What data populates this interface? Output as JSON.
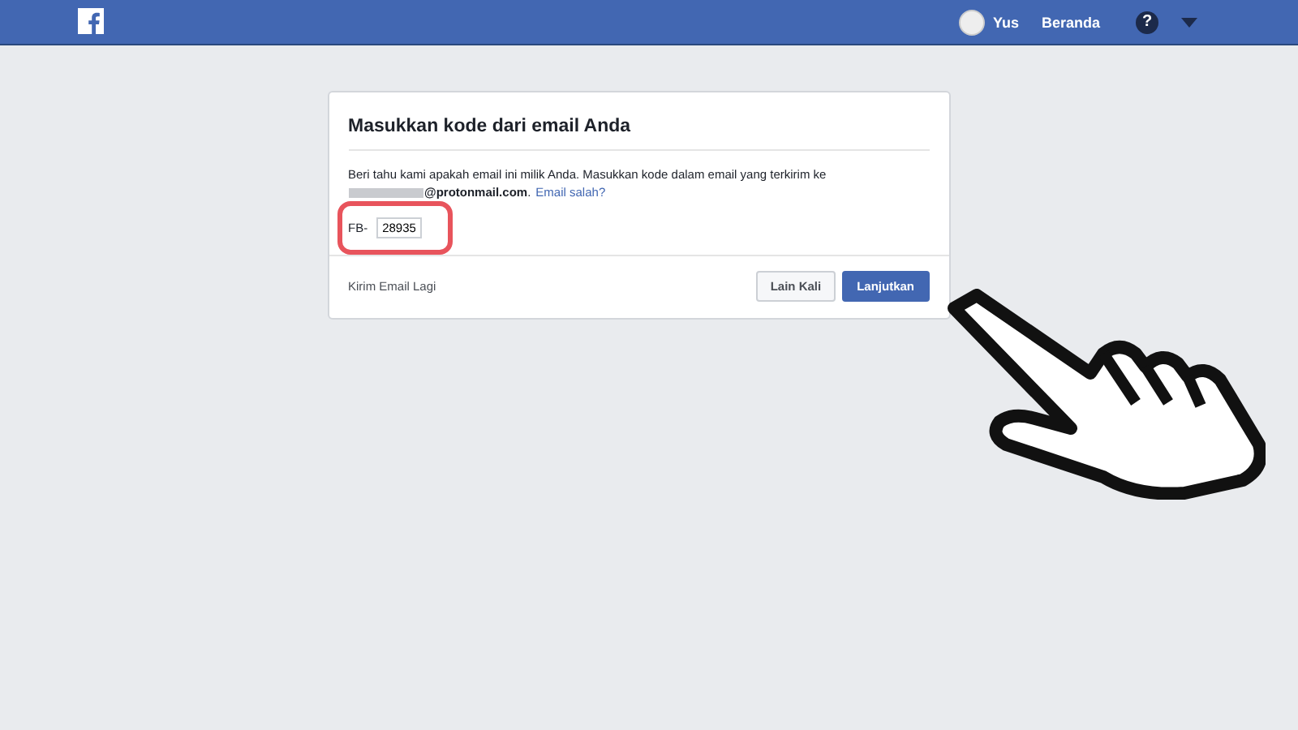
{
  "topbar": {
    "user": "Yus",
    "home": "Beranda",
    "help": "?"
  },
  "dialog": {
    "title": "Masukkan kode dari email Anda",
    "message": "Beri tahu kami apakah email ini milik Anda. Masukkan kode dalam email yang terkirim ke",
    "email": "**@protonmail.com**.",
    "email_link": "Email salah?",
    "code_prefix": "FB-",
    "code_value": "28935",
    "code_highlighted": true,
    "resend_link": "Kirim Email Lagi",
    "buttons": [
      {
        "label": "Lain Kali",
        "kind": "secondary"
      },
      {
        "label": "Lanjutkan",
        "kind": "primary"
      }
    ]
  },
  "pointer_annotation": true
}
